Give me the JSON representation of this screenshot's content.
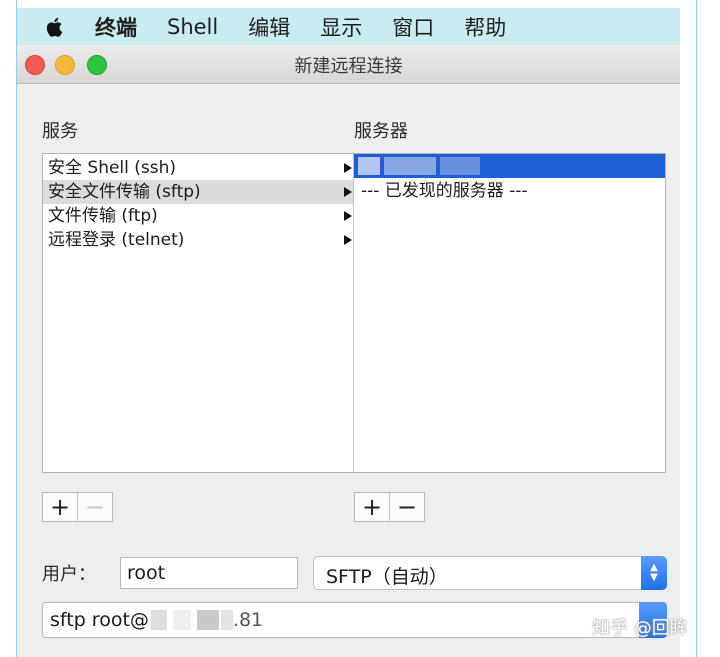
{
  "menubar": {
    "items": [
      "终端",
      "Shell",
      "编辑",
      "显示",
      "窗口",
      "帮助"
    ]
  },
  "window": {
    "title": "新建远程连接"
  },
  "services": {
    "heading": "服务",
    "items": [
      {
        "label": "安全 Shell (ssh)"
      },
      {
        "label": "安全文件传输 (sftp)"
      },
      {
        "label": "文件传输 (ftp)"
      },
      {
        "label": "远程登录 (telnet)"
      }
    ],
    "selected_index": 1
  },
  "servers": {
    "heading": "服务器",
    "discovered_label": "--- 已发现的服务器 ---"
  },
  "buttons": {
    "add": "+",
    "remove": "−"
  },
  "user": {
    "label": "用户：",
    "value": "root"
  },
  "protocol_select": {
    "value": "SFTP（自动）"
  },
  "command": {
    "value": "sftp root@",
    "suffix": ".81"
  },
  "watermark": "知乎 @回眸",
  "colors": {
    "menubar_bg": "#c9ecf0",
    "selection_blue": "#1f5fd6",
    "accent_blue": "#1f6fe8"
  }
}
